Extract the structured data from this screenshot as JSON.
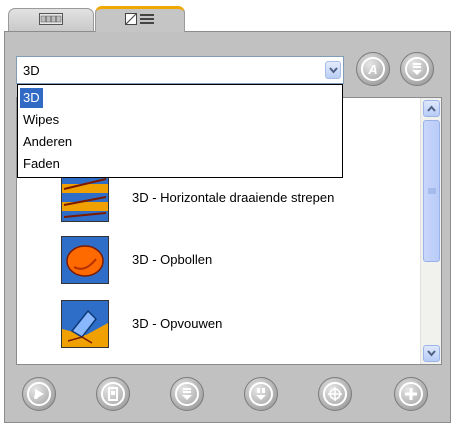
{
  "tabs": [
    {
      "icon": "filmstrip-icon",
      "active": false
    },
    {
      "icon": "image-list-icon",
      "active": true
    }
  ],
  "combo": {
    "value": "3D"
  },
  "dropdown": {
    "options": [
      "3D",
      "Wipes",
      "Anderen",
      "Faden"
    ],
    "selected_index": 0
  },
  "top_buttons": [
    {
      "icon": "text-a-icon",
      "glyph": "A"
    },
    {
      "icon": "list-down-icon",
      "glyph": "▾"
    }
  ],
  "list": {
    "items": [
      {
        "label": "3D - Horizontale draaiende strepen",
        "icon": "horizontal-stripes-transition-icon"
      },
      {
        "label": "3D - Opbollen",
        "icon": "bulge-transition-icon"
      },
      {
        "label": "3D - Opvouwen",
        "icon": "fold-transition-icon"
      }
    ]
  },
  "bottom_buttons": [
    {
      "icon": "preview-transition-icon",
      "glyph": ""
    },
    {
      "icon": "clip-icon",
      "glyph": ""
    },
    {
      "icon": "move-down-icon",
      "glyph": ""
    },
    {
      "icon": "list-down-icon",
      "glyph": ""
    },
    {
      "icon": "target-icon",
      "glyph": "⊕"
    },
    {
      "icon": "add-icon",
      "glyph": "+"
    }
  ],
  "colors": {
    "selection": "#316ac5",
    "tab_accent": "#f0a800",
    "panel_bg": "#c1c1c1"
  }
}
